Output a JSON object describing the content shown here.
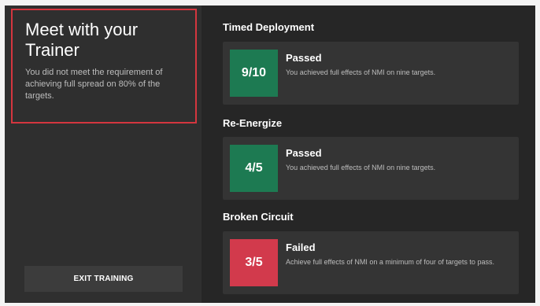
{
  "trainer": {
    "title": "Meet with your Trainer",
    "description": "You did not meet the requirement of achieving full spread on 80% of the targets."
  },
  "exit_button_label": "EXIT TRAINING",
  "sections": [
    {
      "title": "Timed Deployment",
      "score": "9/10",
      "status": "Passed",
      "detail": "You achieved full effects of NMI on nine targets.",
      "color": "#1d7a52"
    },
    {
      "title": "Re-Energize",
      "score": "4/5",
      "status": "Passed",
      "detail": "You achieved full effects of NMI on nine targets.",
      "color": "#1d7a52"
    },
    {
      "title": "Broken Circuit",
      "score": "3/5",
      "status": "Failed",
      "detail": "Achieve full effects of NMI on a minimum of four of targets to pass.",
      "color": "#d23a4c"
    }
  ]
}
